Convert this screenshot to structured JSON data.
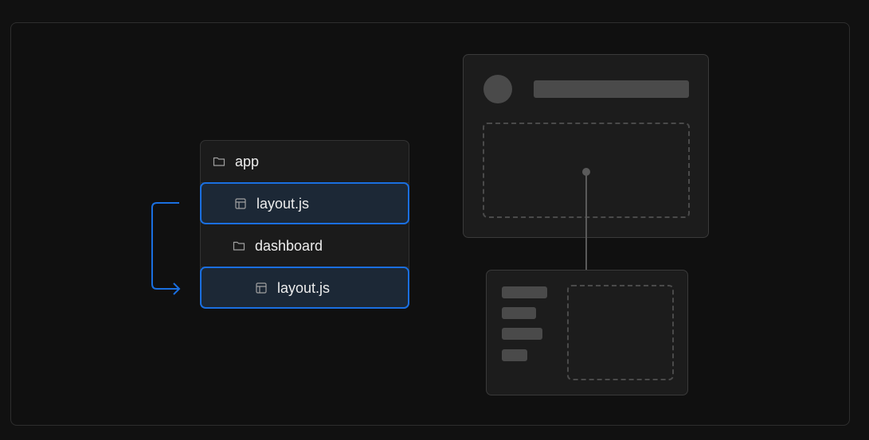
{
  "file_tree": {
    "items": [
      {
        "label": "app",
        "icon": "folder-icon"
      },
      {
        "label": "layout.js",
        "icon": "layout-file-icon",
        "highlighted": true
      },
      {
        "label": "dashboard",
        "icon": "folder-icon"
      },
      {
        "label": "layout.js",
        "icon": "layout-file-icon",
        "highlighted": true
      }
    ]
  },
  "colors": {
    "background": "#111111",
    "panel": "#1b1b1b",
    "highlight_border": "#1a6fe0",
    "highlight_fill": "#1c2836",
    "placeholder": "#4a4a4a",
    "text": "#ededed"
  }
}
